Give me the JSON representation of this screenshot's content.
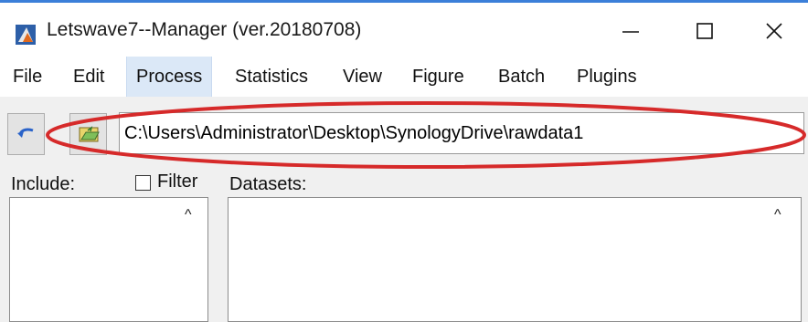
{
  "window": {
    "title": "Letswave7--Manager (ver.20180708)",
    "icons": [
      "app-icon",
      "minimize-icon",
      "maximize-icon",
      "close-icon"
    ]
  },
  "menu": {
    "items": [
      {
        "label": "File"
      },
      {
        "label": "Edit"
      },
      {
        "label": "Process"
      },
      {
        "label": "Statistics"
      },
      {
        "label": "View"
      },
      {
        "label": "Figure"
      },
      {
        "label": "Batch"
      },
      {
        "label": "Plugins"
      }
    ],
    "active": "Process"
  },
  "toolbar": {
    "path": "C:\\Users\\Administrator\\Desktop\\SynologyDrive\\rawdata1",
    "icons": [
      "back-arrow-icon",
      "folder-icon"
    ]
  },
  "panels": {
    "include_label": "Include:",
    "filter_label": "Filter",
    "filter_checked": false,
    "datasets_label": "Datasets:"
  },
  "colors": {
    "highlight_ellipse": "#d62a2a",
    "menu_active_bg": "#dbe8f7",
    "title_accent": "#3b7fd9"
  }
}
